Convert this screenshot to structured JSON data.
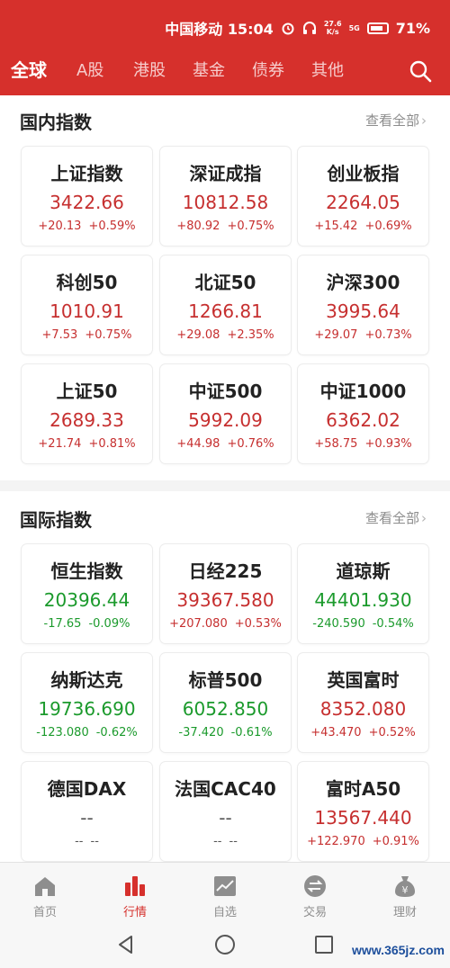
{
  "status_bar": {
    "carrier_time": "中国移动 15:04",
    "net_speed_top": "27.6",
    "net_speed_bottom": "K/s",
    "signal": "5G",
    "battery": "71%",
    "alarm_icon": "alarm-icon",
    "headphone_icon": "headphone-icon"
  },
  "nav": {
    "tabs": [
      "全球",
      "A股",
      "港股",
      "基金",
      "债券",
      "其他"
    ],
    "active": "全球",
    "search_icon": "search-icon"
  },
  "domestic": {
    "title": "国内指数",
    "more": "查看全部",
    "cards": [
      {
        "name": "上证指数",
        "value": "3422.66",
        "change": "+20.13",
        "pct": "+0.59%",
        "dir": "up"
      },
      {
        "name": "深证成指",
        "value": "10812.58",
        "change": "+80.92",
        "pct": "+0.75%",
        "dir": "up"
      },
      {
        "name": "创业板指",
        "value": "2264.05",
        "change": "+15.42",
        "pct": "+0.69%",
        "dir": "up"
      },
      {
        "name": "科创50",
        "value": "1010.91",
        "change": "+7.53",
        "pct": "+0.75%",
        "dir": "up"
      },
      {
        "name": "北证50",
        "value": "1266.81",
        "change": "+29.08",
        "pct": "+2.35%",
        "dir": "up"
      },
      {
        "name": "沪深300",
        "value": "3995.64",
        "change": "+29.07",
        "pct": "+0.73%",
        "dir": "up"
      },
      {
        "name": "上证50",
        "value": "2689.33",
        "change": "+21.74",
        "pct": "+0.81%",
        "dir": "up"
      },
      {
        "name": "中证500",
        "value": "5992.09",
        "change": "+44.98",
        "pct": "+0.76%",
        "dir": "up"
      },
      {
        "name": "中证1000",
        "value": "6362.02",
        "change": "+58.75",
        "pct": "+0.93%",
        "dir": "up"
      }
    ]
  },
  "international": {
    "title": "国际指数",
    "more": "查看全部",
    "cards": [
      {
        "name": "恒生指数",
        "value": "20396.44",
        "change": "-17.65",
        "pct": "-0.09%",
        "dir": "down"
      },
      {
        "name": "日经225",
        "value": "39367.580",
        "change": "+207.080",
        "pct": "+0.53%",
        "dir": "up"
      },
      {
        "name": "道琼斯",
        "value": "44401.930",
        "change": "-240.590",
        "pct": "-0.54%",
        "dir": "down"
      },
      {
        "name": "纳斯达克",
        "value": "19736.690",
        "change": "-123.080",
        "pct": "-0.62%",
        "dir": "down"
      },
      {
        "name": "标普500",
        "value": "6052.850",
        "change": "-37.420",
        "pct": "-0.61%",
        "dir": "down"
      },
      {
        "name": "英国富时",
        "value": "8352.080",
        "change": "+43.470",
        "pct": "+0.52%",
        "dir": "up"
      },
      {
        "name": "德国DAX",
        "value": "--",
        "change": "--",
        "pct": "--",
        "dir": "flat"
      },
      {
        "name": "法国CAC40",
        "value": "--",
        "change": "--",
        "pct": "--",
        "dir": "flat"
      },
      {
        "name": "富时A50",
        "value": "13567.440",
        "change": "+122.970",
        "pct": "+0.91%",
        "dir": "up"
      }
    ]
  },
  "bottom_tabs": [
    {
      "label": "首页",
      "icon": "home-icon"
    },
    {
      "label": "行情",
      "icon": "market-icon"
    },
    {
      "label": "自选",
      "icon": "watchlist-icon"
    },
    {
      "label": "交易",
      "icon": "trade-icon"
    },
    {
      "label": "理财",
      "icon": "wealth-icon"
    }
  ],
  "active_bottom_tab": "行情",
  "watermark": "www.365jz.com",
  "colors": {
    "brand_red": "#d6302c",
    "up": "#c62f2f",
    "down": "#1b9a2c"
  }
}
